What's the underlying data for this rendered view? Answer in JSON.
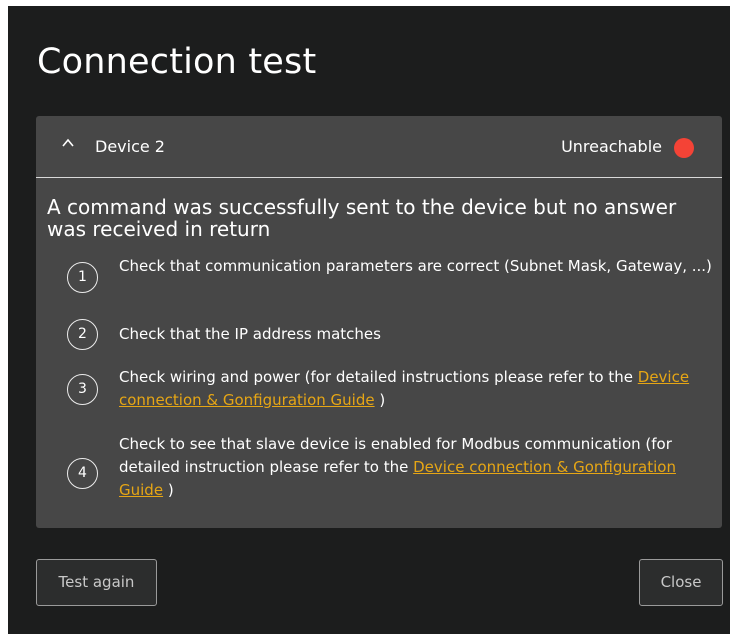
{
  "dialog": {
    "title": "Connection test"
  },
  "device": {
    "name": "Device 2",
    "status": "Unreachable",
    "status_color": "#f44336"
  },
  "message": "A command was successfully sent to the device but no answer was received in return",
  "steps": [
    {
      "number": "1",
      "text": "Check that communication parameters are correct (Subnet Mask, Gateway, ...)"
    },
    {
      "number": "2",
      "text": "Check that the IP address matches"
    },
    {
      "number": "3",
      "text_before": "Check wiring and power (for detailed instructions please refer to the ",
      "link": "Device connection & Gonfiguration Guide",
      "text_after": " )"
    },
    {
      "number": "4",
      "text_before": "Check to see that slave device is enabled for Modbus communication (for detailed instruction please refer to the ",
      "link": "Device connection & Gonfiguration Guide",
      "text_after": " )"
    }
  ],
  "buttons": {
    "test_again": "Test again",
    "close": "Close"
  },
  "colors": {
    "dialog_bg": "#1c1d1d",
    "panel_bg": "#474747",
    "link": "#e6a615"
  },
  "icons": {
    "collapse": "chevron-up-icon"
  }
}
